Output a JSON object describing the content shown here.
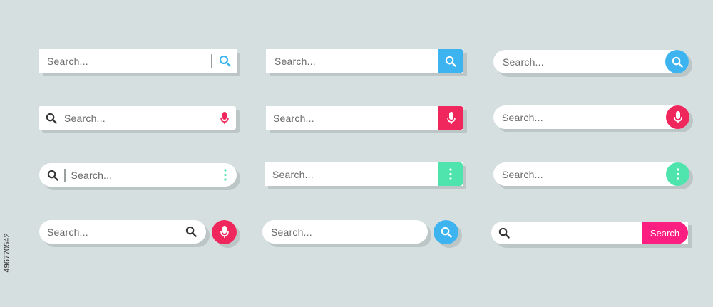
{
  "colors": {
    "background": "#d6dfdf",
    "blue": "#3db4ef",
    "red": "#f0275d",
    "mint": "#4fe3ad",
    "pink": "#fd1e82",
    "shadow": "#bcc6c6"
  },
  "bars": [
    {
      "placeholder": "Search...",
      "icons": [
        "divider",
        "search-icon"
      ]
    },
    {
      "placeholder": "Search...",
      "icons": [
        "search-icon"
      ]
    },
    {
      "placeholder": "Search...",
      "icons": [
        "search-icon"
      ]
    },
    {
      "placeholder": "Search...",
      "icons": [
        "search-icon",
        "microphone-icon"
      ]
    },
    {
      "placeholder": "Search...",
      "icons": [
        "microphone-icon"
      ]
    },
    {
      "placeholder": "Search...",
      "icons": [
        "microphone-icon"
      ]
    },
    {
      "placeholder": "Search...",
      "icons": [
        "search-icon",
        "more-vertical-icon"
      ]
    },
    {
      "placeholder": "Search...",
      "icons": [
        "more-vertical-icon"
      ]
    },
    {
      "placeholder": "Search...",
      "icons": [
        "more-vertical-icon"
      ]
    },
    {
      "placeholder": "Search...",
      "icons": [
        "search-icon",
        "microphone-icon"
      ]
    },
    {
      "placeholder": "Search...",
      "icons": [
        "search-icon"
      ]
    },
    {
      "placeholder": "",
      "button_label": "Search",
      "icons": [
        "search-icon"
      ]
    }
  ],
  "stock_id": "496770542"
}
